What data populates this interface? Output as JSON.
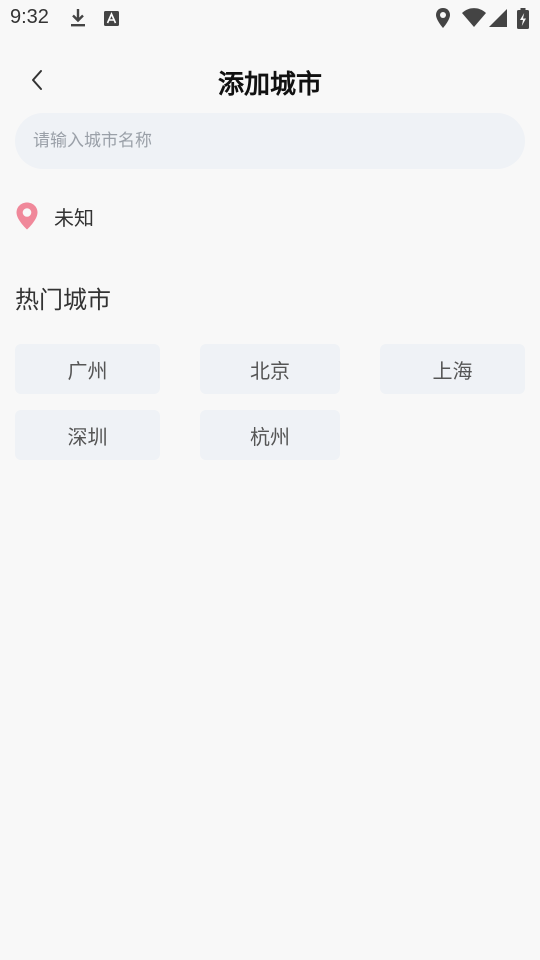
{
  "status_bar": {
    "time": "9:32",
    "icons": [
      "download-icon",
      "a-badge-icon",
      "location-icon",
      "wifi-icon",
      "signal-icon",
      "battery-charging-icon"
    ]
  },
  "header": {
    "title": "添加城市",
    "back_icon": "chevron-left-icon"
  },
  "search": {
    "placeholder": "请输入城市名称",
    "value": ""
  },
  "location": {
    "icon": "location-pin-icon",
    "text": "未知",
    "color": "#f0889a"
  },
  "hot_cities": {
    "title": "热门城市",
    "cities": [
      "广州",
      "北京",
      "上海",
      "深圳",
      "杭州"
    ]
  },
  "colors": {
    "background": "#f8f8f8",
    "chip_background": "#eff2f6",
    "pin": "#f0889a"
  }
}
